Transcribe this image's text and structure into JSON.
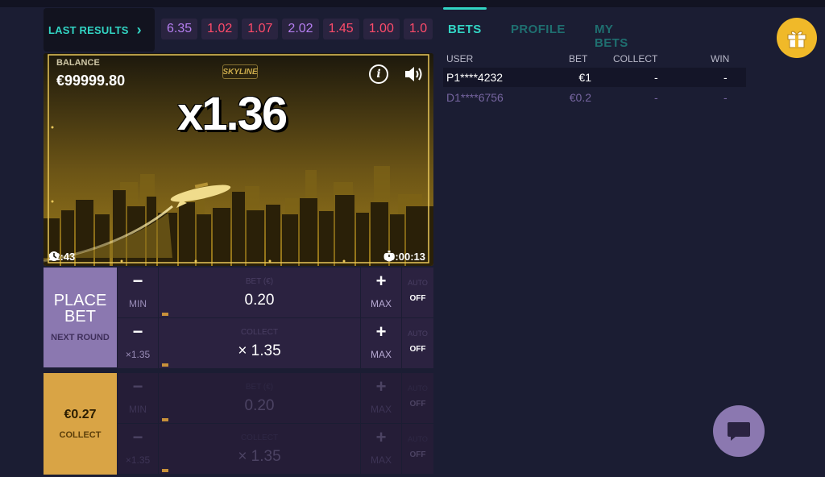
{
  "results": {
    "label": "LAST RESULTS",
    "chips": [
      {
        "value": "6.35",
        "color": "#b57ef0"
      },
      {
        "value": "1.02",
        "color": "#ff4b6a"
      },
      {
        "value": "1.07",
        "color": "#ff4b6a"
      },
      {
        "value": "2.02",
        "color": "#b57ef0"
      },
      {
        "value": "1.45",
        "color": "#ff4b6a"
      },
      {
        "value": "1.00",
        "color": "#ff4b6a"
      },
      {
        "value": "1.0",
        "color": "#ff4b6a"
      }
    ]
  },
  "game": {
    "balance_label": "BALANCE",
    "balance_value": "€99999.80",
    "logo": "SKYLINE",
    "multiplier": "x1.36",
    "clock": "12:43",
    "timer": "00:00:13"
  },
  "panel1": {
    "place_bet": "PLACE BET",
    "next_round": "NEXT ROUND",
    "bet_row": {
      "minus": "−",
      "min_label": "MIN",
      "input_label": "BET (€)",
      "value": "0.20",
      "plus": "+",
      "max_label": "MAX",
      "auto_label": "AUTO",
      "auto_value": "OFF"
    },
    "collect_row": {
      "minus": "−",
      "sub_label": "×1.35",
      "input_label": "COLLECT",
      "value": "× 1.35",
      "plus": "+",
      "max_label": "MAX",
      "auto_label": "AUTO",
      "auto_value": "OFF"
    }
  },
  "panel2": {
    "amount": "€0.27",
    "collect_label": "COLLECT",
    "bet_row": {
      "minus": "−",
      "min_label": "MIN",
      "input_label": "BET (€)",
      "value": "0.20",
      "plus": "+",
      "max_label": "MAX",
      "auto_label": "AUTO",
      "auto_value": "OFF"
    },
    "collect_row": {
      "minus": "−",
      "sub_label": "×1.35",
      "input_label": "COLLECT",
      "value": "× 1.35",
      "plus": "+",
      "max_label": "MAX",
      "auto_label": "AUTO",
      "auto_value": "OFF"
    }
  },
  "tabs": {
    "bets": "BETS",
    "profile": "PROFILE",
    "my_bets": "MY BETS"
  },
  "table": {
    "headers": {
      "user": "USER",
      "bet": "BET",
      "collect": "COLLECT",
      "win": "WIN"
    },
    "rows": [
      {
        "user": "P1****4232",
        "bet": "€1",
        "collect": "-",
        "win": "-"
      },
      {
        "user": "D1****6756",
        "bet": "€0.2",
        "collect": "-",
        "win": "-"
      }
    ]
  },
  "colors": {
    "accent": "#32d5c4",
    "place_bet": "#8b78b0",
    "collect": "#d9a445",
    "gift": "#f0b929"
  },
  "icons": {
    "gift": "gift-icon",
    "chat": "chat-icon",
    "info": "info-icon",
    "sound": "speaker-icon",
    "clock": "clock-icon",
    "timer": "stopwatch-icon"
  }
}
